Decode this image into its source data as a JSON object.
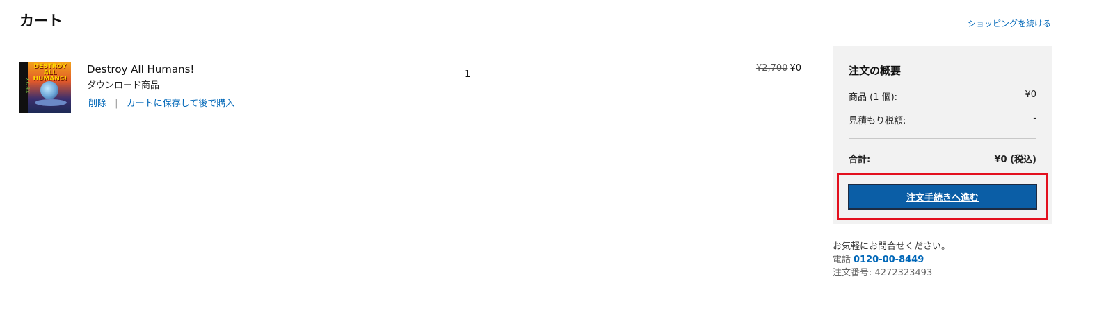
{
  "page": {
    "title": "カート",
    "continue_shopping": "ショッピングを続ける"
  },
  "cart_items": [
    {
      "title": "Destroy All Humans!",
      "type": "ダウンロード商品",
      "thumbnail_text": "DESTROY ALL HUMANS!",
      "platform_band": "XBOX",
      "remove_label": "削除",
      "save_later_label": "カートに保存して後で購入",
      "quantity": "1",
      "original_price": "¥2,700",
      "price": "¥0"
    }
  ],
  "summary": {
    "title": "注文の概要",
    "items_label": "商品 (1 個):",
    "items_value": "¥0",
    "tax_label": "見積もり税額:",
    "tax_value": "-",
    "total_label": "合計:",
    "total_value": "¥0 (税込)",
    "checkout_button": "注文手続きへ進む"
  },
  "contact": {
    "heading": "お気軽にお問合せください。",
    "phone_label": "電話",
    "phone_number": "0120-00-8449",
    "order_number_label": "注文番号: 4272323493"
  },
  "colors": {
    "accent": "#0067b8",
    "button": "#0b5ea6",
    "highlight_border": "#e3101e",
    "summary_bg": "#f2f2f2"
  }
}
